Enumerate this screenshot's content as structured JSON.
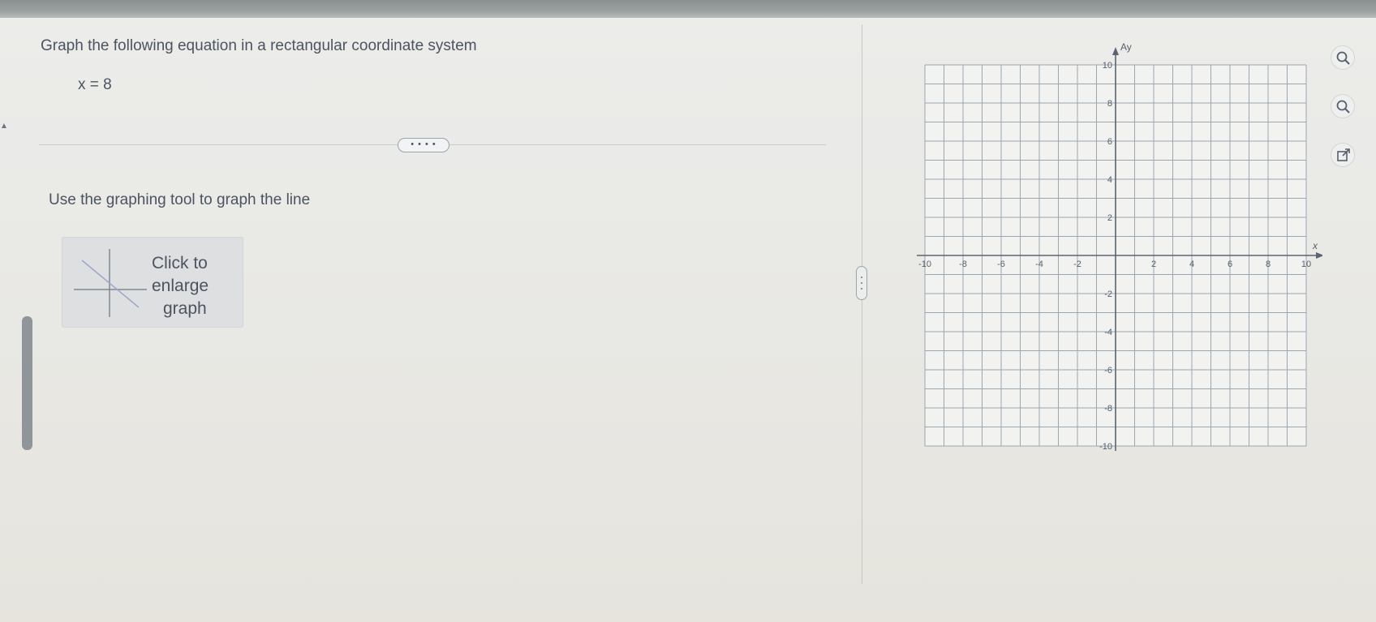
{
  "problem": {
    "question": "Graph the following equation in a rectangular coordinate system",
    "equation": "x = 8",
    "expander_label": "• • • •"
  },
  "instructions": {
    "text": "Use the graphing tool to graph the line"
  },
  "enlarge_button": {
    "line1": "Click to",
    "line2": "enlarge",
    "line3": "graph"
  },
  "graph": {
    "y_axis_label": "Ay",
    "x_axis_label": "x",
    "x_range": [
      -10,
      10
    ],
    "y_range": [
      -10,
      10
    ],
    "grid_step": 1,
    "label_step": 2,
    "x_tick_labels": [
      "-10",
      "-8",
      "-6",
      "-4",
      "-2",
      "2",
      "4",
      "6",
      "8",
      "10"
    ],
    "y_tick_labels": [
      "10",
      "8",
      "6",
      "4",
      "2",
      "-2",
      "-4",
      "-6",
      "-8",
      "-10"
    ],
    "grid_color": "#9aa6b0",
    "axis_color": "#5a6470"
  },
  "tools": [
    {
      "name": "zoom-in-icon"
    },
    {
      "name": "zoom-out-icon"
    },
    {
      "name": "popout-icon"
    }
  ]
}
